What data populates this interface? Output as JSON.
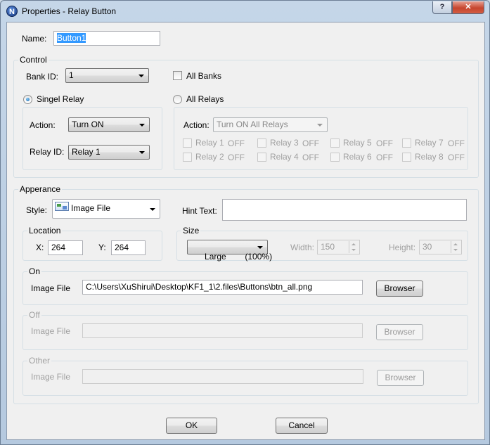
{
  "window": {
    "title": "Properties - Relay Button",
    "app_icon_letter": "N",
    "help": "?",
    "close": "✕"
  },
  "name": {
    "label": "Name:",
    "value": "Button1"
  },
  "control": {
    "title": "Control",
    "bank_label": "Bank ID:",
    "bank_value": "1",
    "all_banks": "All Banks",
    "singel_relay": "Singel Relay",
    "all_relays": "All Relays",
    "action_label": "Action:",
    "action_value": "Turn ON",
    "relay_id_label": "Relay ID:",
    "relay_id_value": "Relay 1",
    "all_action_label": "Action:",
    "all_action_value": "Turn ON All Relays",
    "relays": [
      {
        "name": "Relay 1",
        "state": "OFF"
      },
      {
        "name": "Relay 2",
        "state": "OFF"
      },
      {
        "name": "Relay 3",
        "state": "OFF"
      },
      {
        "name": "Relay 4",
        "state": "OFF"
      },
      {
        "name": "Relay 5",
        "state": "OFF"
      },
      {
        "name": "Relay 6",
        "state": "OFF"
      },
      {
        "name": "Relay 7",
        "state": "OFF"
      },
      {
        "name": "Relay 8",
        "state": "OFF"
      }
    ]
  },
  "appearance": {
    "title": "Apperance",
    "style_label": "Style:",
    "style_value": "Image File",
    "hint_label": "Hint Text:",
    "hint_value": "",
    "location_title": "Location",
    "x_label": "X:",
    "x_value": "264",
    "y_label": "Y:",
    "y_value": "264",
    "size_title": "Size",
    "size_value": "Large        (100%)",
    "width_label": "Width:",
    "width_value": "150",
    "height_label": "Height:",
    "height_value": "30",
    "on": {
      "title": "On",
      "label": "Image File",
      "value": "C:\\Users\\XuShirui\\Desktop\\KF1_1\\2.files\\Buttons\\btn_all.png",
      "button": "Browser"
    },
    "off": {
      "title": "Off",
      "label": "Image File",
      "value": "",
      "button": "Browser"
    },
    "other": {
      "title": "Other",
      "label": "Image File",
      "value": "",
      "button": "Browser"
    }
  },
  "buttons": {
    "ok": "OK",
    "cancel": "Cancel"
  }
}
